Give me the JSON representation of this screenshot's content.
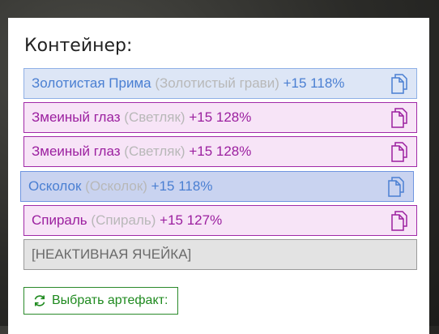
{
  "container": {
    "title": "Контейнер:",
    "slots": [
      {
        "name": "Золотистая Прима",
        "original": "(Золотистый грави)",
        "bonus": "+15 118%",
        "color": "blue"
      },
      {
        "name": "Змеиный глаз",
        "original": "(Светляк)",
        "bonus": "+15 128%",
        "color": "pink"
      },
      {
        "name": "Змеиный глаз",
        "original": "(Светляк)",
        "bonus": "+15 128%",
        "color": "pink"
      },
      {
        "name": "Осколок",
        "original": "(Осколок)",
        "bonus": "+15 118%",
        "color": "blue",
        "selected": true
      },
      {
        "name": "Спираль",
        "original": "(Спираль)",
        "bonus": "+15 127%",
        "color": "pink"
      }
    ],
    "inactive_label": "[НЕАКТИВНАЯ ЯЧЕЙКА]",
    "choose_button": "Выбрать артефакт:"
  },
  "icons": {
    "copy": "copy-icon",
    "refresh": "refresh-icon"
  },
  "colors": {
    "blue_text": "#4a7fd2",
    "pink_text": "#9b1f9f",
    "button_green": "#1f8a1f"
  }
}
